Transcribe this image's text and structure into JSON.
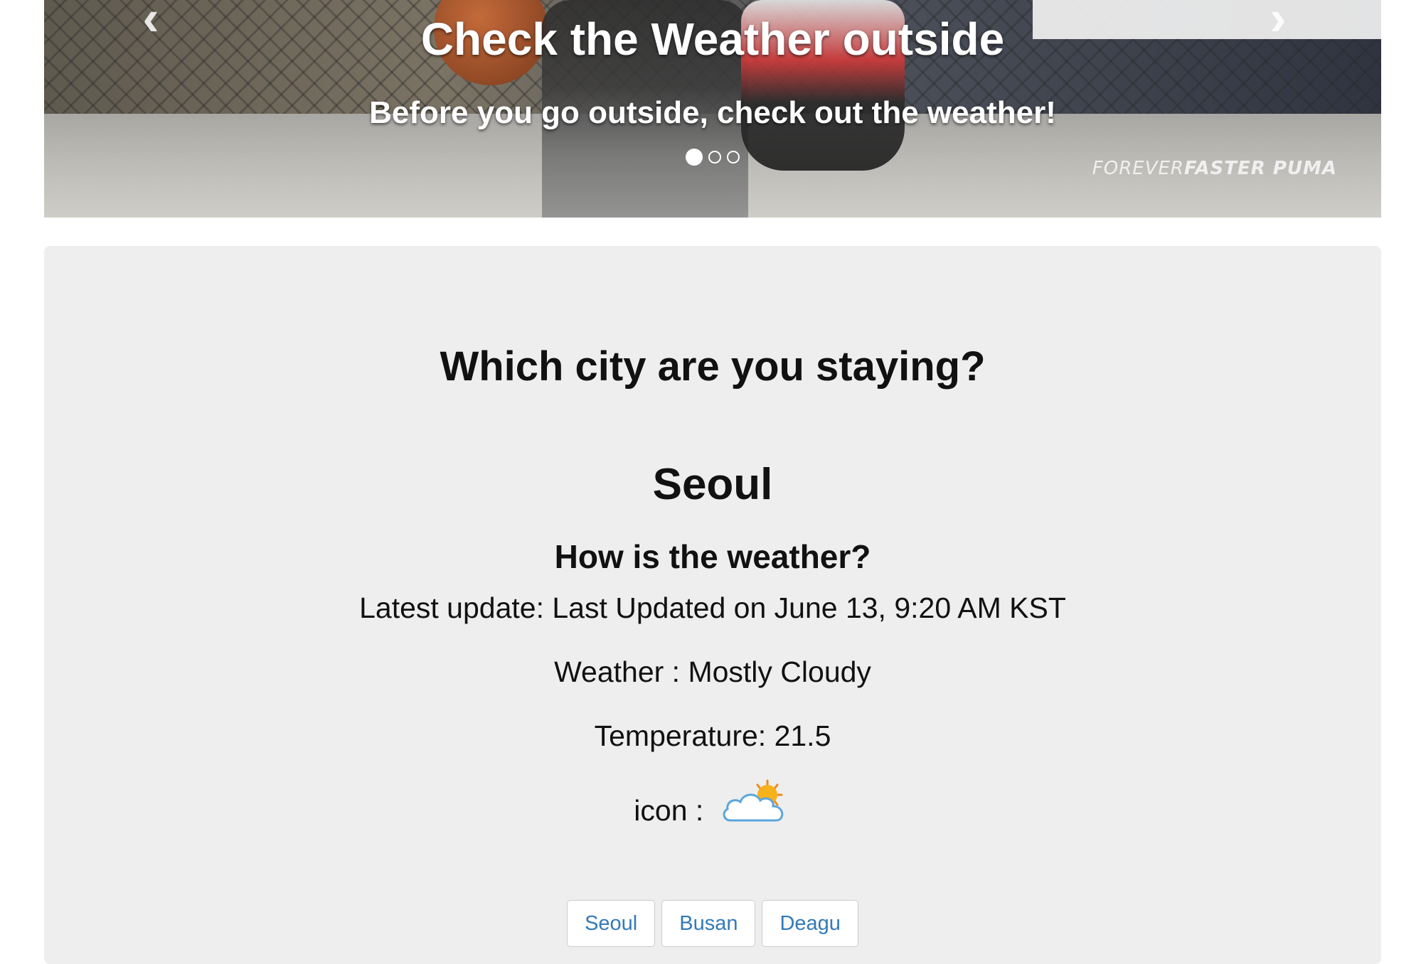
{
  "carousel": {
    "title": "Check the Weather outside",
    "subtitle": "Before you go outside, check out the weather!",
    "prev_glyph": "‹",
    "next_glyph": "›",
    "brand_light": "FOREVER",
    "brand_bold": "FASTER PUMA",
    "slide_count": 3,
    "active_slide": 1
  },
  "main": {
    "heading": "Which city are you staying?",
    "city": "Seoul",
    "subheading": "How is the weather?",
    "update_text": "Latest update: Last Updated on June 13, 9:20 AM KST",
    "weather_text": "Weather : Mostly Cloudy",
    "temperature_text": "Temperature: 21.5",
    "icon_label": "icon :",
    "icon_name": "partly-cloudy-icon"
  },
  "city_buttons": [
    "Seoul",
    "Busan",
    "Deagu"
  ],
  "colors": {
    "panel_bg": "#eeeeee",
    "link_blue": "#337ab7"
  }
}
